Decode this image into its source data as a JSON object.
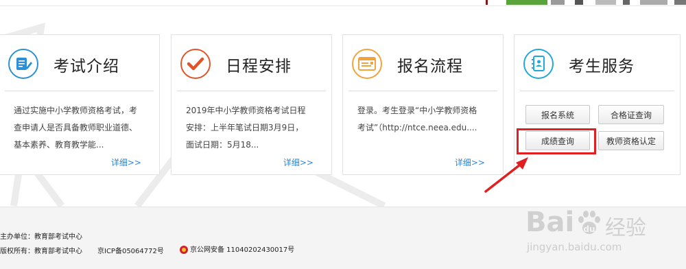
{
  "cards": [
    {
      "title": "考试介绍",
      "icon": "document-edit-icon",
      "accent": "#2d8fd5",
      "desc_lines": [
        "通过实施中小学教师资格考试，考",
        "查申请人是否具备教师职业道德、",
        "基本素养、教育教学能..."
      ],
      "more": "详细>>"
    },
    {
      "title": "日程安排",
      "icon": "checkmark-icon",
      "accent": "#e0542a",
      "desc_lines": [
        "2019年中小学教师资格考试日程",
        "安排：上半年笔试日期3月9日，",
        "面试日期：5月18..."
      ],
      "more": "详细>>"
    },
    {
      "title": "报名流程",
      "icon": "browser-form-icon",
      "accent": "#f0a43a",
      "desc_lines": [
        "登录。考生登录“中小学教师资格",
        "考试”（http://ntce.neea.edu...."
      ],
      "more": "详细>>"
    },
    {
      "title": "考生服务",
      "icon": "contact-book-icon",
      "accent": "#22a8d8"
    }
  ],
  "services": {
    "register": "报名系统",
    "certificate_query": "合格证查询",
    "score_query": "成绩查询",
    "qualification": "教师资格认定"
  },
  "footer": {
    "host": "主办单位：教育部考试中心",
    "copyright": "版权所有：教育部考试中心",
    "icp": "京ICP备05064772号",
    "police": "京公网安备 11040202430017号"
  },
  "watermark": {
    "brand": "Bai",
    "brand2": "经验",
    "url": "jingyan.baidu.com"
  },
  "colors": {
    "link": "#2a86d8",
    "highlight": "#e02020"
  }
}
